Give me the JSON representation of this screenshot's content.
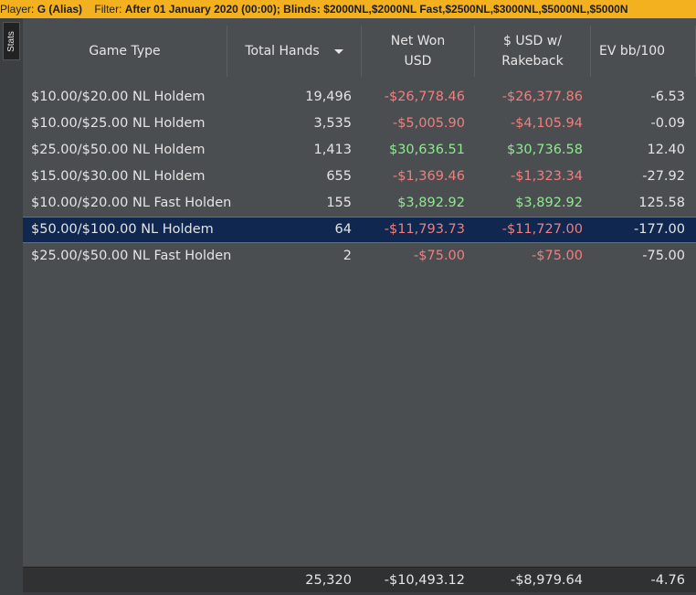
{
  "filter_bar": {
    "player_label": "Player:",
    "player_value": "G (Alias)",
    "filter_label": "Filter:",
    "filter_value": "After 01 January 2020 (00:00); Blinds: $2000NL,$2000NL Fast,$2500NL,$3000NL,$5000NL,$5000N"
  },
  "side_tab": {
    "label": "Stats"
  },
  "table": {
    "columns": [
      {
        "label": "Game Type"
      },
      {
        "label": "Total Hands"
      },
      {
        "label": "Net Won\nUSD"
      },
      {
        "label": "$ USD w/\nRakeback"
      },
      {
        "label": "EV bb/100"
      }
    ],
    "sort_column": "Total Hands",
    "rows": [
      {
        "game": "$10.00/$20.00 NL Holdem",
        "hands": "19,496",
        "net": "-$26,778.46",
        "usd_rb": "-$26,377.86",
        "ev": "-6.53",
        "sign": "neg"
      },
      {
        "game": "$10.00/$25.00 NL Holdem",
        "hands": "3,535",
        "net": "-$5,005.90",
        "usd_rb": "-$4,105.94",
        "ev": "-0.09",
        "sign": "neg"
      },
      {
        "game": "$25.00/$50.00 NL Holdem",
        "hands": "1,413",
        "net": "$30,636.51",
        "usd_rb": "$30,736.58",
        "ev": "12.40",
        "sign": "pos"
      },
      {
        "game": "$15.00/$30.00 NL Holdem",
        "hands": "655",
        "net": "-$1,369.46",
        "usd_rb": "-$1,323.34",
        "ev": "-27.92",
        "sign": "neg"
      },
      {
        "game": "$10.00/$20.00 NL Fast Holden",
        "hands": "155",
        "net": "$3,892.92",
        "usd_rb": "$3,892.92",
        "ev": "125.58",
        "sign": "pos"
      },
      {
        "game": "$50.00/$100.00 NL Holdem",
        "hands": "64",
        "net": "-$11,793.73",
        "usd_rb": "-$11,727.00",
        "ev": "-177.00",
        "sign": "neg",
        "selected": true
      },
      {
        "game": "$25.00/$50.00 NL Fast Holden",
        "hands": "2",
        "net": "-$75.00",
        "usd_rb": "-$75.00",
        "ev": "-75.00",
        "sign": "neg"
      }
    ],
    "totals": {
      "hands": "25,320",
      "net": "-$10,493.12",
      "usd_rb": "-$8,979.64",
      "ev": "-4.76"
    }
  },
  "colors": {
    "filter_bar_bg": "#f3b11f",
    "negative": "#f07f7f",
    "positive": "#8fea8f",
    "selected_row": "#10284f"
  }
}
